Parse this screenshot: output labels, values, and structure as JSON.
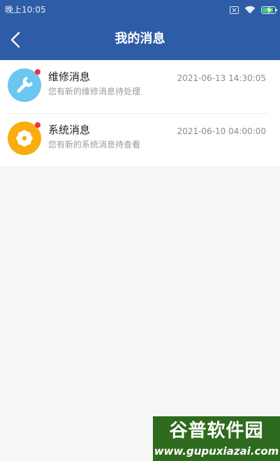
{
  "status_bar": {
    "time": "晚上10:05",
    "icons": [
      "notification-blocked-icon",
      "wifi-icon",
      "battery-charging-icon"
    ],
    "battery_color": "#3fcf71"
  },
  "header": {
    "title": "我的消息",
    "back_icon": "chevron-left-icon",
    "background": "#2f5ca6"
  },
  "messages": [
    {
      "title": "维修消息",
      "subtitle": "您有新的维修消息待处理",
      "time": "2021-06-13 14:30:05",
      "icon": "wrench-icon",
      "icon_color": "#6ac7ef",
      "unread": true
    },
    {
      "title": "系统消息",
      "subtitle": "您有新的系统消息待查看",
      "time": "2021-06-10 04:00:00",
      "icon": "gear-icon",
      "icon_color": "#f9ad0e",
      "unread": true
    }
  ],
  "watermark": {
    "brand": "谷普软件园",
    "url": "www.gupuxiazai.com"
  }
}
